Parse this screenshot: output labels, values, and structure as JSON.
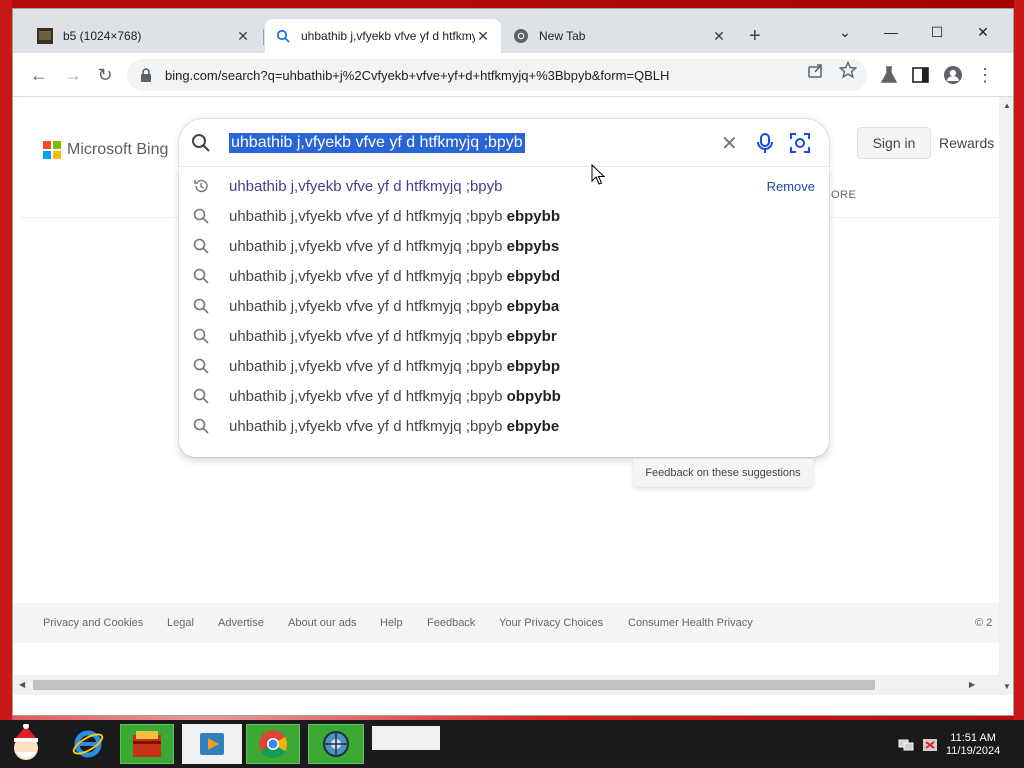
{
  "window": {
    "tabs": [
      {
        "title": "b5 (1024×768)",
        "active": false
      },
      {
        "title": "uhbathib j,vfyekb vfve yf d htfkmyjq ;bpyb - Search",
        "active": true
      },
      {
        "title": "New Tab",
        "active": false
      }
    ],
    "tab_close": "✕",
    "new_tab": "+",
    "controls": {
      "dropdown": "⌄",
      "minimize": "—",
      "maximize": "☐",
      "close": "✕"
    }
  },
  "toolbar": {
    "back": "←",
    "forward": "→",
    "reload": "↻",
    "url": "bing.com/search?q=uhbathib+j%2Cvfyekb+vfve+yf+d+htfkmyjq+%3Bbpyb&form=QBLH",
    "menu": "⋮"
  },
  "page": {
    "brand": "Microsoft Bing",
    "query": "uhbathib j,vfyekb vfve yf d htfkmyjq ;bpyb",
    "clear": "✕",
    "sign_in": "Sign in",
    "rewards": "Rewards",
    "more_label": "ORE",
    "suggestions": [
      {
        "type": "history",
        "text": "uhbathib j,vfyekb vfve yf d htfkmyjq ;bpyb",
        "bold": "",
        "action": "Remove"
      },
      {
        "type": "search",
        "text": "uhbathib j,vfyekb vfve yf d htfkmyjq ;bpyb ",
        "bold": "ebpybb"
      },
      {
        "type": "search",
        "text": "uhbathib j,vfyekb vfve yf d htfkmyjq ;bpyb ",
        "bold": "ebpybs"
      },
      {
        "type": "search",
        "text": "uhbathib j,vfyekb vfve yf d htfkmyjq ;bpyb ",
        "bold": "ebpybd"
      },
      {
        "type": "search",
        "text": "uhbathib j,vfyekb vfve yf d htfkmyjq ;bpyb ",
        "bold": "ebpyba"
      },
      {
        "type": "search",
        "text": "uhbathib j,vfyekb vfve yf d htfkmyjq ;bpyb ",
        "bold": "ebpybr"
      },
      {
        "type": "search",
        "text": "uhbathib j,vfyekb vfve yf d htfkmyjq ;bpyb ",
        "bold": "ebpybp"
      },
      {
        "type": "search",
        "text": "uhbathib j,vfyekb vfve yf d htfkmyjq ;bpyb ",
        "bold": "obpybb"
      },
      {
        "type": "search",
        "text": "uhbathib j,vfyekb vfve yf d htfkmyjq ;bpyb ",
        "bold": "ebpybe"
      }
    ],
    "feedback": "Feedback on these suggestions",
    "footer_links": [
      "Privacy and Cookies",
      "Legal",
      "Advertise",
      "About our ads",
      "Help",
      "Feedback",
      "Your Privacy Choices",
      "Consumer Health Privacy"
    ],
    "footer_copyright": "© 2"
  },
  "taskbar": {
    "time": "11:51 AM",
    "date": "11/19/2024"
  },
  "colors": {
    "selection": "#2a65d6",
    "ms_red": "#f25022",
    "ms_green": "#7fba00",
    "ms_blue": "#00a4ef",
    "ms_yellow": "#ffb900",
    "taskbar_green": "#3aaa35"
  }
}
